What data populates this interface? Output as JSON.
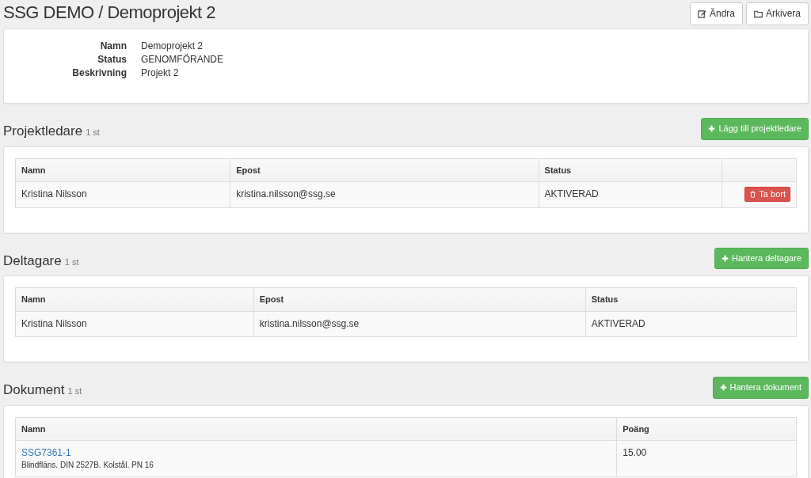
{
  "title": "SSG DEMO / Demoprojekt 2",
  "header_buttons": [
    {
      "kind": "edit",
      "label": "Ändra"
    },
    {
      "kind": "archive",
      "label": "Arkivera"
    }
  ],
  "details": [
    {
      "label": "Namn",
      "value": "Demoprojekt 2"
    },
    {
      "label": "Status",
      "value": "GENOMFÖRANDE"
    },
    {
      "label": "Beskrivning",
      "value": "Projekt 2"
    }
  ],
  "sections": [
    {
      "title": "Projektledare",
      "count": "1 st",
      "button": "Lägg till projektledare",
      "columns": [
        "Namn",
        "Epost",
        "Status",
        ""
      ],
      "rows": [
        {
          "cells": [
            {
              "kind": "text",
              "text": "Kristina Nilsson"
            },
            {
              "kind": "text",
              "text": "kristina.nilsson@ssg.se"
            },
            {
              "kind": "text",
              "text": "AKTIVERAD"
            },
            {
              "kind": "delete",
              "text": "Ta bort"
            }
          ]
        }
      ]
    },
    {
      "title": "Deltagare",
      "count": "1 st",
      "button": "Hantera deltagare",
      "columns": [
        "Namn",
        "Epost",
        "Status"
      ],
      "rows": [
        {
          "cells": [
            {
              "kind": "text",
              "text": "Kristina Nilsson"
            },
            {
              "kind": "text",
              "text": "kristina.nilsson@ssg.se"
            },
            {
              "kind": "text",
              "text": "AKTIVERAD"
            }
          ]
        }
      ]
    },
    {
      "title": "Dokument",
      "count": "1 st",
      "button": "Hantera dokument",
      "columns": [
        "Namn",
        "Poäng"
      ],
      "rows": [
        {
          "cells": [
            {
              "kind": "link",
              "text": "SSG7361-1",
              "subtext": "Blindfläns. DIN 2527B. Kolstål. PN 16"
            },
            {
              "kind": "text",
              "text": "15.00"
            }
          ]
        }
      ]
    }
  ]
}
